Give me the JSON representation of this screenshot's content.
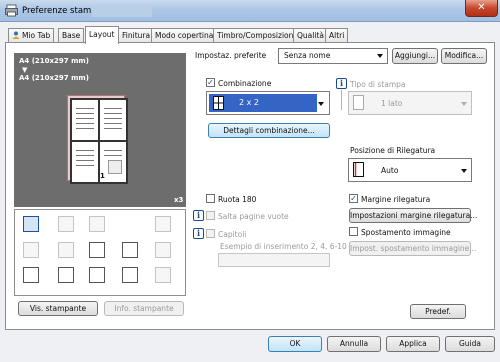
{
  "window": {
    "title": "Preferenze stampa -",
    "close_symbol": "✕"
  },
  "tabs": [
    {
      "label": "Mio Tab",
      "icon": "user-icon"
    },
    {
      "label": "Base"
    },
    {
      "label": "Layout",
      "active": true
    },
    {
      "label": "Finitura"
    },
    {
      "label": "Modo copertina"
    },
    {
      "label": "Timbro/Composizione"
    },
    {
      "label": "Qualità"
    },
    {
      "label": "Altri"
    }
  ],
  "preview": {
    "paper_original": "A4 (210x297 mm)",
    "arrow": "▼",
    "paper_output": "A4 (210x297 mm)",
    "page_number": "1",
    "copies": "x3"
  },
  "left_buttons": {
    "printer_view": "Vis. stampante",
    "printer_info": "Info. stampante"
  },
  "preferred": {
    "label": "Impostaz. preferite",
    "value": "Senza nome",
    "add_button": "Aggiungi...",
    "edit_button": "Modifica..."
  },
  "combination": {
    "label": "Combinazione",
    "checked": true,
    "value": "2 x 2",
    "details_button": "Dettagli combinazione..."
  },
  "print_type": {
    "label": "Tipo di stampa",
    "value": "1 lato"
  },
  "binding": {
    "label": "Posizione di Rilegatura",
    "value": "Auto"
  },
  "rotate180": {
    "label": "Ruota 180",
    "checked": false
  },
  "skip_blank": {
    "label": "Salta pagine vuote",
    "checked": false
  },
  "chapters": {
    "label": "Capitoli",
    "checked": false,
    "example": "Esempio di inserimento 2, 4, 6-10"
  },
  "binding_margin": {
    "label": "Margine rilegatura",
    "checked": true,
    "button": "Impostazioni margine rilegatura..."
  },
  "image_shift": {
    "label": "Spostamento immagine",
    "checked": false,
    "button": "Impost. spostamento immagine..."
  },
  "defaults_button": "Predef.",
  "footer": {
    "ok": "OK",
    "cancel": "Annulla",
    "apply": "Applica",
    "help": "Guida"
  },
  "info_symbol": "i",
  "check_symbol": "✓",
  "colors": {
    "accent": "#3464c4",
    "preview_bg": "#6d6d6d",
    "titlebar": "#adc7e6"
  }
}
